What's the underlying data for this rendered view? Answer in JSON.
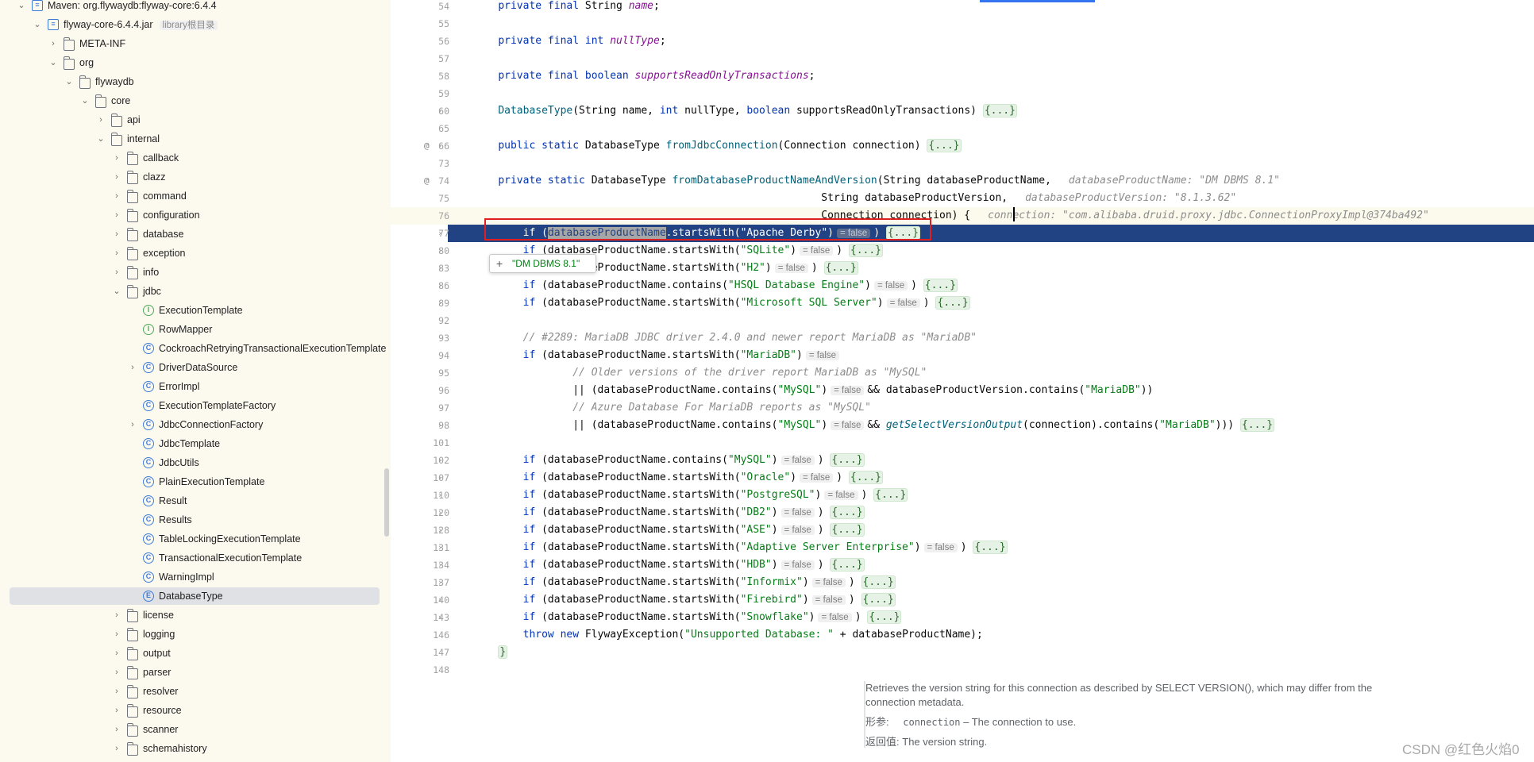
{
  "tree": {
    "items": [
      {
        "label": "Maven: org.flywaydb:flyway-core:6.4.4",
        "icon": "maven-library-icon",
        "depth": 0,
        "expanded": true
      },
      {
        "label": "flyway-core-6.4.4.jar",
        "hint": "library根目录",
        "icon": "jar-icon",
        "depth": 1,
        "expanded": true
      },
      {
        "label": "META-INF",
        "icon": "folder-icon",
        "depth": 2,
        "expanded": false
      },
      {
        "label": "org",
        "icon": "folder-icon",
        "depth": 2,
        "expanded": true
      },
      {
        "label": "flywaydb",
        "icon": "folder-icon",
        "depth": 3,
        "expanded": true
      },
      {
        "label": "core",
        "icon": "folder-icon",
        "depth": 4,
        "expanded": true
      },
      {
        "label": "api",
        "icon": "folder-icon",
        "depth": 5,
        "expanded": false
      },
      {
        "label": "internal",
        "icon": "folder-icon",
        "depth": 5,
        "expanded": true
      },
      {
        "label": "callback",
        "icon": "folder-icon",
        "depth": 6,
        "expanded": false
      },
      {
        "label": "clazz",
        "icon": "folder-icon",
        "depth": 6,
        "expanded": false
      },
      {
        "label": "command",
        "icon": "folder-icon",
        "depth": 6,
        "expanded": false
      },
      {
        "label": "configuration",
        "icon": "folder-icon",
        "depth": 6,
        "expanded": false
      },
      {
        "label": "database",
        "icon": "folder-icon",
        "depth": 6,
        "expanded": false
      },
      {
        "label": "exception",
        "icon": "folder-icon",
        "depth": 6,
        "expanded": false
      },
      {
        "label": "info",
        "icon": "folder-icon",
        "depth": 6,
        "expanded": false
      },
      {
        "label": "jdbc",
        "icon": "folder-icon",
        "depth": 6,
        "expanded": true
      },
      {
        "label": "ExecutionTemplate",
        "icon": "interface-icon",
        "depth": 7
      },
      {
        "label": "RowMapper",
        "icon": "interface-icon",
        "depth": 7
      },
      {
        "label": "CockroachRetryingTransactionalExecutionTemplate",
        "icon": "class-icon",
        "depth": 7
      },
      {
        "label": "DriverDataSource",
        "icon": "class-icon",
        "depth": 7,
        "expanded": false
      },
      {
        "label": "ErrorImpl",
        "icon": "class-icon",
        "depth": 7
      },
      {
        "label": "ExecutionTemplateFactory",
        "icon": "class-icon",
        "depth": 7
      },
      {
        "label": "JdbcConnectionFactory",
        "icon": "class-icon",
        "depth": 7,
        "expanded": false
      },
      {
        "label": "JdbcTemplate",
        "icon": "class-icon",
        "depth": 7
      },
      {
        "label": "JdbcUtils",
        "icon": "class-icon",
        "depth": 7
      },
      {
        "label": "PlainExecutionTemplate",
        "icon": "class-icon",
        "depth": 7
      },
      {
        "label": "Result",
        "icon": "class-icon",
        "depth": 7
      },
      {
        "label": "Results",
        "icon": "class-icon",
        "depth": 7
      },
      {
        "label": "TableLockingExecutionTemplate",
        "icon": "class-icon",
        "depth": 7
      },
      {
        "label": "TransactionalExecutionTemplate",
        "icon": "class-icon",
        "depth": 7
      },
      {
        "label": "WarningImpl",
        "icon": "class-icon",
        "depth": 7
      },
      {
        "label": "DatabaseType",
        "icon": "enum-icon",
        "depth": 7,
        "selected": true
      },
      {
        "label": "license",
        "icon": "folder-icon",
        "depth": 6,
        "expanded": false
      },
      {
        "label": "logging",
        "icon": "folder-icon",
        "depth": 6,
        "expanded": false
      },
      {
        "label": "output",
        "icon": "folder-icon",
        "depth": 6,
        "expanded": false
      },
      {
        "label": "parser",
        "icon": "folder-icon",
        "depth": 6,
        "expanded": false
      },
      {
        "label": "resolver",
        "icon": "folder-icon",
        "depth": 6,
        "expanded": false
      },
      {
        "label": "resource",
        "icon": "folder-icon",
        "depth": 6,
        "expanded": false
      },
      {
        "label": "scanner",
        "icon": "folder-icon",
        "depth": 6,
        "expanded": false
      },
      {
        "label": "schemahistory",
        "icon": "folder-icon",
        "depth": 6,
        "expanded": false
      }
    ]
  },
  "editor": {
    "lines": [
      {
        "n": "54",
        "html": "    <span class=\"kw\">private final</span> String <span class=\"fld\">name</span>;"
      },
      {
        "n": "55",
        "html": ""
      },
      {
        "n": "56",
        "html": "    <span class=\"kw\">private final int</span> <span class=\"fld\">nullType</span>;"
      },
      {
        "n": "57",
        "html": ""
      },
      {
        "n": "58",
        "html": "    <span class=\"kw\">private final boolean</span> <span class=\"fld\">supportsReadOnlyTransactions</span>;"
      },
      {
        "n": "59",
        "html": ""
      },
      {
        "n": "60",
        "fold": true,
        "html": "    <span class=\"fn\">DatabaseType</span>(String name, <span class=\"kw\">int</span> nullType, <span class=\"kw\">boolean</span> supportsReadOnlyTransactions) <span class=\"fb\">{...}</span>"
      },
      {
        "n": "65",
        "html": ""
      },
      {
        "n": "66",
        "fold": true,
        "at": true,
        "html": "    <span class=\"kw\">public static</span> DatabaseType <span class=\"fn\">fromJdbcConnection</span>(Connection connection) <span class=\"fb\">{...}</span>"
      },
      {
        "n": "73",
        "html": ""
      },
      {
        "n": "74",
        "at": true,
        "html": "    <span class=\"kw\">private static</span> DatabaseType <span class=\"fn\">fromDatabaseProductNameAndVersion</span>(String databaseProductName,<span class=\"hn\">databaseProductName: \"DM DBMS 8.1\"</span>"
      },
      {
        "n": "75",
        "html": "                                                        String databaseProductVersion,<span class=\"hn\">databaseProductVersion: \"8.1.3.62\"</span>"
      },
      {
        "n": "76",
        "cur": true,
        "html": "                                                        Connection connection) {<span class=\"hn\">connection: \"com.alibaba.druid.proxy.jdbc.ConnectionProxyImpl@374ba492\"</span>"
      },
      {
        "n": "77",
        "fold": true,
        "hl": true,
        "html": "        <span class=\"kw\">if</span> (<span class=\"sel-word\">databaseProductName</span>.startsWith(<span class=\"str\">\"Apache Derby\"</span>)<span class=\"hint\">= false</span>) <span class=\"fb\">{...}</span>"
      },
      {
        "n": "80",
        "fold": true,
        "html": "        <span class=\"kw\">if</span> (databaseProductName.startsWith(<span class=\"str\">\"SQLite\"</span>)<span class=\"hint\">= false</span>) <span class=\"fb\">{...}</span>"
      },
      {
        "n": "83",
        "fold": true,
        "html": "        <span class=\"kw\">if</span> (databaseProductName.startsWith(<span class=\"str\">\"H2\"</span>)<span class=\"hint\">= false</span>) <span class=\"fb\">{...}</span>"
      },
      {
        "n": "86",
        "fold": true,
        "html": "        <span class=\"kw\">if</span> (databaseProductName.contains(<span class=\"str\">\"HSQL Database Engine\"</span>)<span class=\"hint\">= false</span>) <span class=\"fb\">{...}</span>"
      },
      {
        "n": "89",
        "fold": true,
        "html": "        <span class=\"kw\">if</span> (databaseProductName.startsWith(<span class=\"str\">\"Microsoft SQL Server\"</span>)<span class=\"hint\">= false</span>) <span class=\"fb\">{...}</span>"
      },
      {
        "n": "92",
        "html": ""
      },
      {
        "n": "93",
        "html": "        <span class=\"cm\">// #2289: MariaDB JDBC driver 2.4.0 and newer report MariaDB as \"MariaDB\"</span>"
      },
      {
        "n": "94",
        "html": "        <span class=\"kw\">if</span> (databaseProductName.startsWith(<span class=\"str\">\"MariaDB\"</span>)<span class=\"hint\">= false</span>"
      },
      {
        "n": "95",
        "html": "                <span class=\"cm\">// Older versions of the driver report MariaDB as \"MySQL\"</span>"
      },
      {
        "n": "96",
        "html": "                || (databaseProductName.contains(<span class=\"str\">\"MySQL\"</span>)<span class=\"hint\">= false</span>&amp;&amp; databaseProductVersion.contains(<span class=\"str\">\"MariaDB\"</span>))"
      },
      {
        "n": "97",
        "html": "                <span class=\"cm\">// Azure Database For MariaDB reports as \"MySQL\"</span>"
      },
      {
        "n": "98",
        "fold": true,
        "html": "                || (databaseProductName.contains(<span class=\"str\">\"MySQL\"</span>)<span class=\"hint\">= false</span>&amp;&amp; <span class=\"fld\" style=\"color:#00627a\">getSelectVersionOutput</span>(connection).contains(<span class=\"str\">\"MariaDB\"</span>))) <span class=\"fb\">{...}</span>"
      },
      {
        "n": "101",
        "html": ""
      },
      {
        "n": "102",
        "fold": true,
        "html": "        <span class=\"kw\">if</span> (databaseProductName.contains(<span class=\"str\">\"MySQL\"</span>)<span class=\"hint\">= false</span>) <span class=\"fb\">{...}</span>"
      },
      {
        "n": "107",
        "fold": true,
        "html": "        <span class=\"kw\">if</span> (databaseProductName.startsWith(<span class=\"str\">\"Oracle\"</span>)<span class=\"hint\">= false</span>) <span class=\"fb\">{...}</span>"
      },
      {
        "n": "110",
        "fold": true,
        "html": "        <span class=\"kw\">if</span> (databaseProductName.startsWith(<span class=\"str\">\"PostgreSQL\"</span>)<span class=\"hint\">= false</span>) <span class=\"fb\">{...}</span>"
      },
      {
        "n": "120",
        "fold": true,
        "html": "        <span class=\"kw\">if</span> (databaseProductName.startsWith(<span class=\"str\">\"DB2\"</span>)<span class=\"hint\">= false</span>) <span class=\"fb\">{...}</span>"
      },
      {
        "n": "128",
        "fold": true,
        "html": "        <span class=\"kw\">if</span> (databaseProductName.startsWith(<span class=\"str\">\"ASE\"</span>)<span class=\"hint\">= false</span>) <span class=\"fb\">{...}</span>"
      },
      {
        "n": "131",
        "fold": true,
        "html": "        <span class=\"kw\">if</span> (databaseProductName.startsWith(<span class=\"str\">\"Adaptive Server Enterprise\"</span>)<span class=\"hint\">= false</span>) <span class=\"fb\">{...}</span>"
      },
      {
        "n": "134",
        "fold": true,
        "html": "        <span class=\"kw\">if</span> (databaseProductName.startsWith(<span class=\"str\">\"HDB\"</span>)<span class=\"hint\">= false</span>) <span class=\"fb\">{...}</span>"
      },
      {
        "n": "137",
        "fold": true,
        "html": "        <span class=\"kw\">if</span> (databaseProductName.startsWith(<span class=\"str\">\"Informix\"</span>)<span class=\"hint\">= false</span>) <span class=\"fb\">{...}</span>"
      },
      {
        "n": "140",
        "fold": true,
        "html": "        <span class=\"kw\">if</span> (databaseProductName.startsWith(<span class=\"str\">\"Firebird\"</span>)<span class=\"hint\">= false</span>) <span class=\"fb\">{...}</span>"
      },
      {
        "n": "143",
        "fold": true,
        "html": "        <span class=\"kw\">if</span> (databaseProductName.startsWith(<span class=\"str\">\"Snowflake\"</span>)<span class=\"hint\">= false</span>) <span class=\"fb\">{...}</span>"
      },
      {
        "n": "146",
        "html": "        <span class=\"kw\">throw new</span> FlywayException(<span class=\"str\">\"Unsupported Database: \"</span> + databaseProductName);"
      },
      {
        "n": "147",
        "html": "    <span class=\"fb\">}</span>"
      },
      {
        "n": "148",
        "html": ""
      }
    ],
    "popup_value": "\"DM DBMS 8.1\"",
    "doc": {
      "desc": "Retrieves the version string for this connection as described by SELECT VERSION(), which may differ from the connection metadata.",
      "param_key": "形参:",
      "param_name": "connection",
      "param_desc": "– The connection to use.",
      "return_key": "返回值:",
      "return_desc": "The version string."
    }
  },
  "watermark": "CSDN @红色火焰0"
}
